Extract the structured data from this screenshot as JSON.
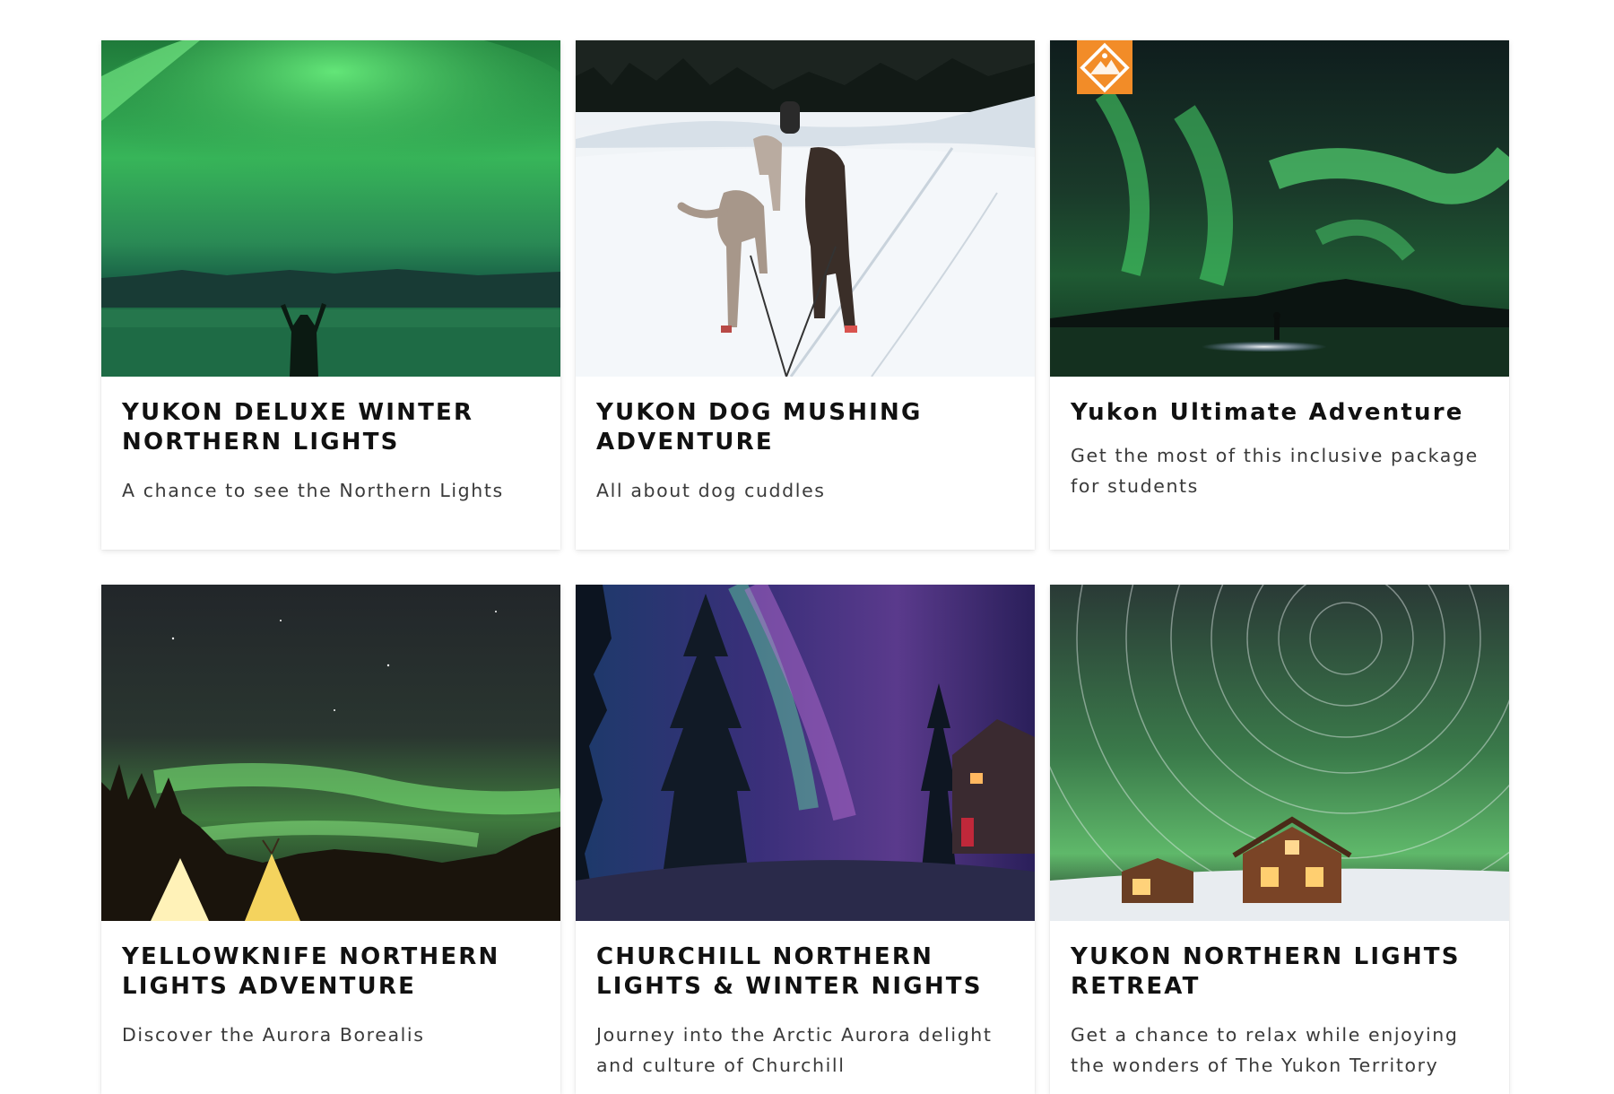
{
  "cards": [
    {
      "title": "YUKON DELUXE WINTER NORTHERN LIGHTS",
      "description": "A chance to see the Northern Lights",
      "image": "aurora-person-lake-photo"
    },
    {
      "title": "YUKON DOG MUSHING ADVENTURE",
      "description": "All about dog cuddles",
      "image": "dog-sled-snow-photo"
    },
    {
      "title": "Yukon Ultimate Adventure",
      "description": "Get the most of this inclusive package for students",
      "image": "aurora-mountain-headlamp-photo",
      "badge": "mountain-logo-badge"
    },
    {
      "title": "YELLOWKNIFE NORTHERN LIGHTS ADVENTURE",
      "description": "Discover the Aurora Borealis",
      "image": "aurora-teepees-photo"
    },
    {
      "title": "CHURCHILL NORTHERN LIGHTS & WINTER NIGHTS",
      "description": "Journey into the Arctic Aurora delight and culture of Churchill",
      "image": "aurora-forest-cabin-photo"
    },
    {
      "title": "YUKON NORTHERN LIGHTS RETREAT",
      "description": "Get a chance to relax while enjoying the wonders of The Yukon Territory",
      "image": "star-trails-lodge-photo"
    }
  ],
  "colors": {
    "badge": "#f28c28",
    "title": "#111111",
    "text": "#3a3a3a",
    "aurora_green": "#3fd36a"
  }
}
